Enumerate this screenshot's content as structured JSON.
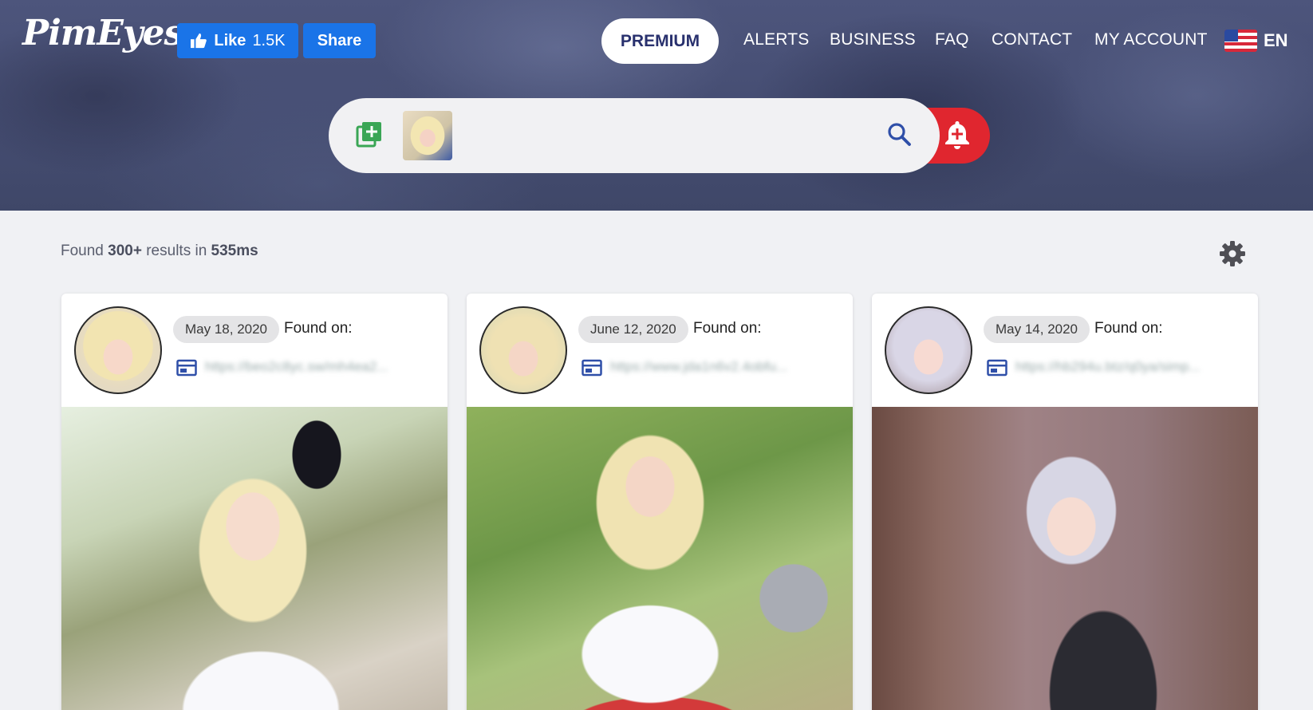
{
  "header": {
    "logo": "PimEyes",
    "facebook": {
      "like_label": "Like",
      "like_count": "1.5K",
      "share_label": "Share"
    },
    "nav": {
      "premium": "PREMIUM",
      "alerts": "ALERTS",
      "business": "BUSINESS",
      "faq": "FAQ",
      "contact": "CONTACT",
      "my_account": "MY ACCOUNT",
      "language": "EN"
    }
  },
  "search": {
    "icons": [
      "add-photo-icon",
      "search-icon",
      "bell-alert-icon"
    ]
  },
  "results": {
    "prefix": "Found ",
    "count": "300+",
    "middle": " results in ",
    "time": "535ms"
  },
  "cards": [
    {
      "date": "May 18, 2020",
      "found_on": "Found on:",
      "url": "https://beo2c8yc.sw/mh4ea2..."
    },
    {
      "date": "June 12, 2020",
      "found_on": "Found on:",
      "url": "https://www.jda1n6v2.4obfu..."
    },
    {
      "date": "May 14, 2020",
      "found_on": "Found on:",
      "url": "https://hb294u.btz/q0ya/simp..."
    }
  ],
  "colors": {
    "header_bg": "#4d557c",
    "facebook_blue": "#1a74e8",
    "premium_text": "#29316e",
    "alert_red": "#e0262f",
    "add_green": "#3aa655",
    "search_blue": "#2f4fa8"
  }
}
